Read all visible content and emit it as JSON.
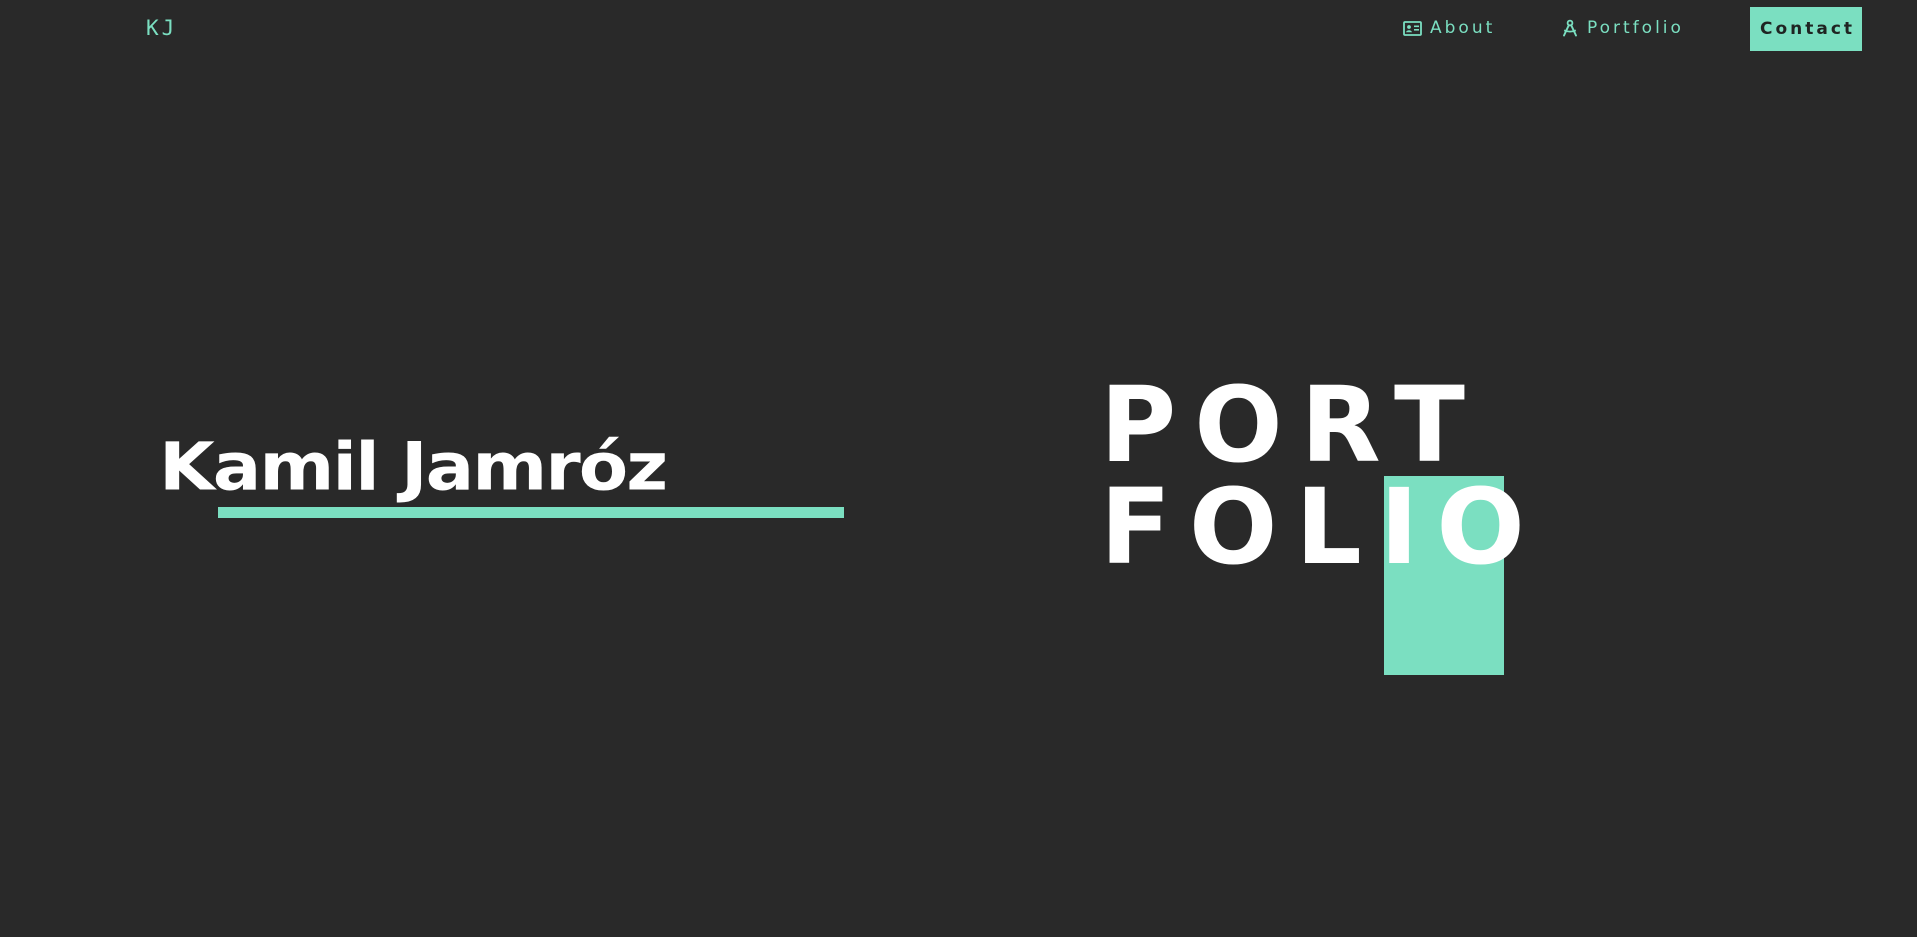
{
  "nav": {
    "logo": "KJ",
    "about_label": "About",
    "portfolio_label": "Portfolio",
    "contact_label": "Contact",
    "about_icon": "id-card-icon",
    "portfolio_icon": "compass-icon"
  },
  "hero": {
    "name": "Kamil Jamróz",
    "title_line1": "PORT",
    "title_line2": "FOLIO"
  },
  "colors": {
    "background": "#292929",
    "accent": "#7bdfc1",
    "text": "#ffffff"
  }
}
